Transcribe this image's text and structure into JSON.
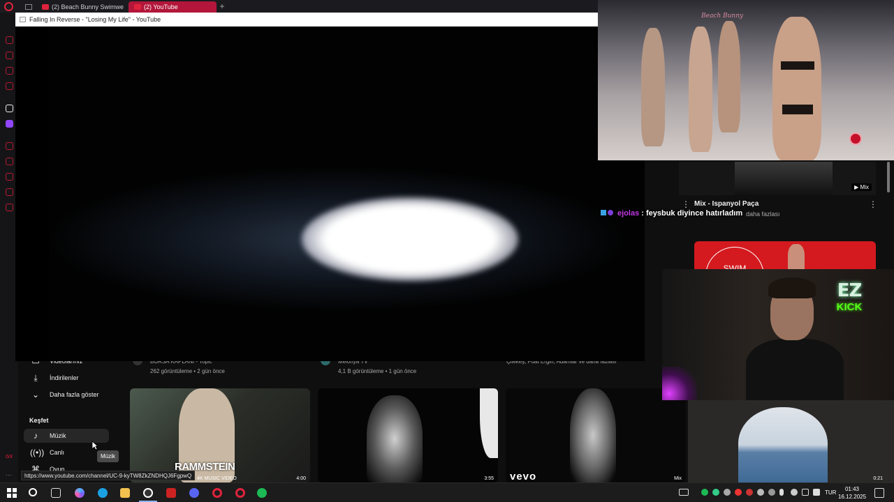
{
  "browser": {
    "tabs": [
      {
        "label": "(2) Beach Bunny Swimwe",
        "active": false
      },
      {
        "label": "(2) YouTube",
        "active": true
      }
    ],
    "new_tab_label": "+"
  },
  "pip": {
    "title": "Falling In Reverse - \"Losing My Life\" - YouTube"
  },
  "runway": {
    "brand_text": "Beach Bunny"
  },
  "recommendations": {
    "mix_badge": "▶ Mix",
    "mix_title": "Mix - Ispanyol Paça",
    "mix_more": "daha fazlası",
    "swim_text": "SWIM"
  },
  "chat": {
    "username": "ejolas",
    "separator": " : ",
    "message": "feysbuk diyince hatırladım"
  },
  "overlay": {
    "ez": "EZ",
    "kick": "KICK"
  },
  "nav": {
    "items": [
      {
        "label": "Videolarınız",
        "icon": "video-icon"
      },
      {
        "label": "İndirilenler",
        "icon": "download-icon"
      },
      {
        "label": "Daha fazla göster",
        "icon": "chevron-down-icon"
      }
    ],
    "section_title": "Keşfet",
    "explore": [
      {
        "label": "Müzik",
        "icon": "music-icon"
      },
      {
        "label": "Canlı",
        "icon": "live-icon"
      },
      {
        "label": "Oyun",
        "icon": "gamepad-icon"
      }
    ],
    "tooltip": "Müzik"
  },
  "videos": [
    {
      "channel": "BURSA KAPLANI - Topic",
      "meta": "262 görüntüleme • 2 gün önce",
      "overlay_title": "RAMMSTEIN",
      "overlay_sub": "4K MUSIC VIDEO",
      "duration": "4:00"
    },
    {
      "channel": "Melonya TV",
      "meta": "4,1 B görüntüleme • 1 gün önce",
      "duration": "3:55"
    },
    {
      "channel": "Çilekeş, Fuat Ergin, Adamlar ve daha fazlası",
      "meta": "",
      "overlay_title": "vevo",
      "duration": "Mix"
    }
  ],
  "cave": {
    "duration": "0:21"
  },
  "status_url": "https://www.youtube.com/channel/UC-9-kyTW8ZkZNDHQJ6FgpwQ",
  "taskbar": {
    "lang": "TUR",
    "time": "01:43",
    "date": "16.12.2025"
  }
}
